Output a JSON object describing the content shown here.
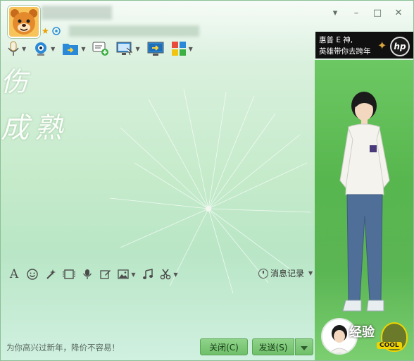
{
  "window": {
    "controls": {
      "menu": "▾",
      "minimize": "–",
      "maximize": "□",
      "close": "✕"
    }
  },
  "toolbar": {
    "items": [
      "microphone-icon",
      "webcam-icon",
      "send-file-icon",
      "create-discussion-icon",
      "remote-assist-icon",
      "share-screen-icon",
      "apps-icon"
    ]
  },
  "ad": {
    "line1": "惠普 E 神,",
    "line2": "英雄带你去跨年",
    "logo": "hp"
  },
  "background_text": {
    "line1": "伤",
    "line2": "成熟"
  },
  "input_toolbar": {
    "icons": [
      "font-icon",
      "emoji-icon",
      "magic-wand-icon",
      "video-icon",
      "voice-icon",
      "edit-icon",
      "image-icon",
      "music-icon",
      "scissors-icon"
    ],
    "history_label": "消息记录"
  },
  "footer": {
    "hint": "为你高兴过新年，降价不容易！",
    "close_label": "关闭(C)",
    "send_label": "发送(S)"
  },
  "watermark": {
    "text": "经验",
    "badge": "COOL"
  },
  "colors": {
    "accent": "#6fbf6a",
    "panel_green": "#58b64f",
    "ad_bg": "#101010"
  }
}
